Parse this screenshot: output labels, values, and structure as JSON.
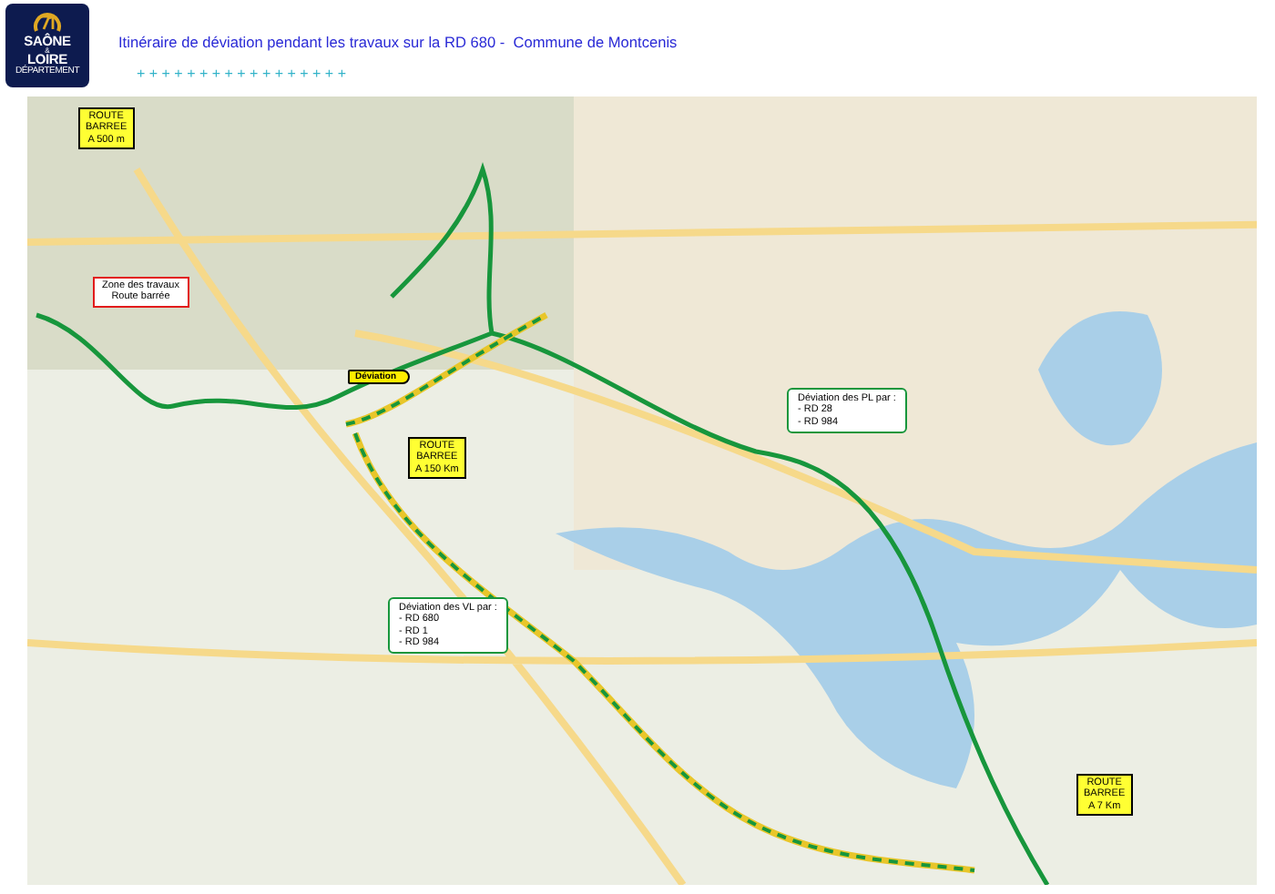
{
  "header": {
    "logo": {
      "line_1": "SAÔNE",
      "ampersand": "&",
      "line_2": "LOIRE",
      "subtitle": "DÉPARTEMENT"
    },
    "title": "Itinéraire de déviation pendant les travaux sur la RD 680 -  Commune de Montcenis",
    "decoration": "+ + + + + + + + + + + + + + + + +"
  },
  "map": {
    "callouts": [
      {
        "kind": "roadblock",
        "lines": [
          "ROUTE",
          "BARREE",
          "A 500 m"
        ]
      },
      {
        "kind": "works",
        "lines": [
          "Zone des travaux",
          "Route barrée"
        ]
      },
      {
        "kind": "detour-sign",
        "lines": [
          "Déviation"
        ]
      },
      {
        "kind": "roadblock",
        "lines": [
          "ROUTE",
          "BARREE",
          "A 150 Km"
        ]
      },
      {
        "kind": "route-list",
        "lines": [
          "Déviation des PL par :",
          "- RD 28",
          "- RD 984"
        ]
      },
      {
        "kind": "route-list",
        "lines": [
          "Déviation des VL par :",
          "- RD 680",
          "- RD 1",
          "- RD 984"
        ]
      },
      {
        "kind": "roadblock",
        "lines": [
          "ROUTE",
          "BARREE",
          "A 7 Km"
        ]
      }
    ]
  }
}
